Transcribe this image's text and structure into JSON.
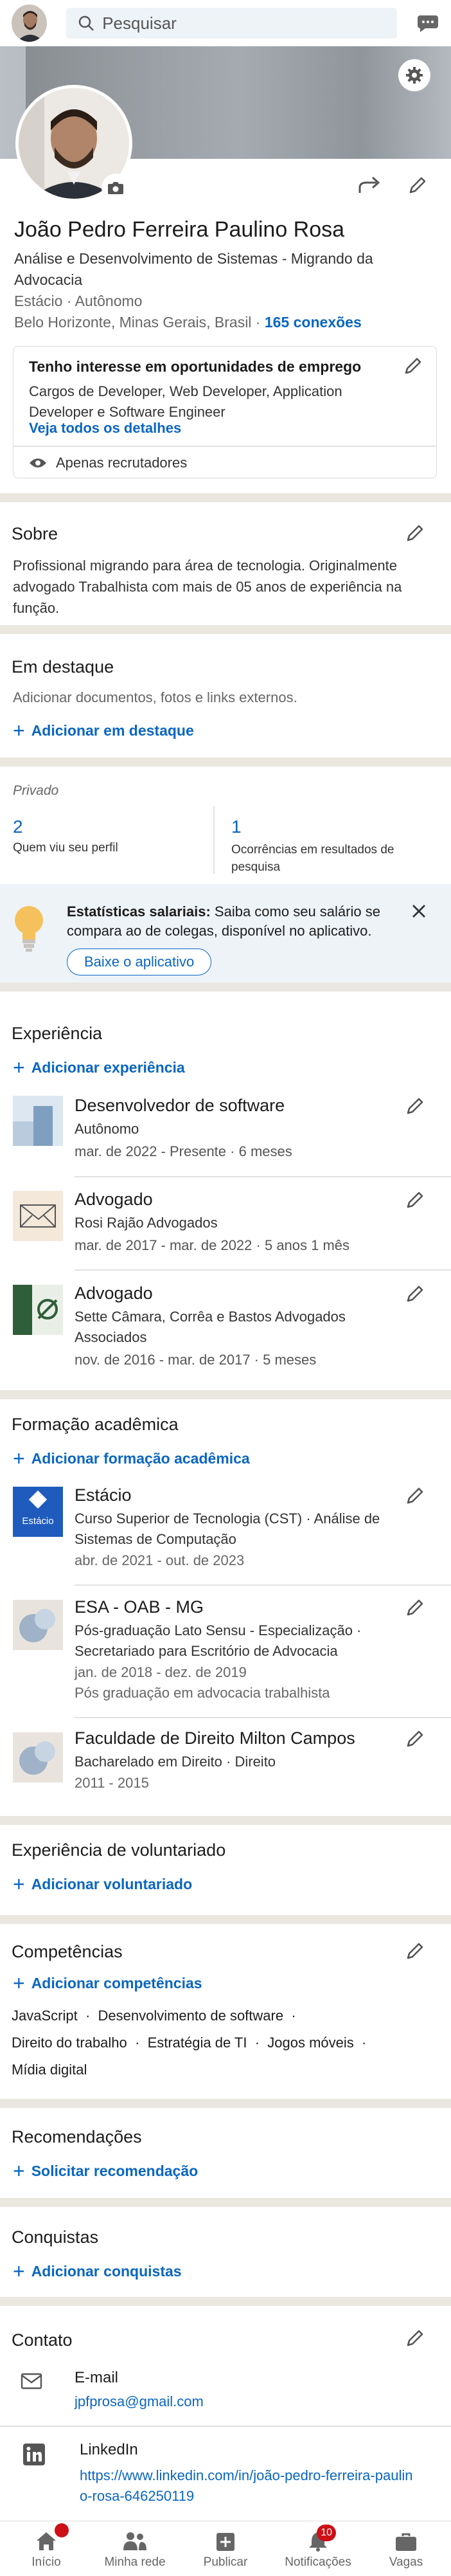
{
  "search": {
    "placeholder": "Pesquisar"
  },
  "profile": {
    "name": "João Pedro Ferreira Paulino Rosa",
    "headline": "Análise e Desenvolvimento de Sistemas - Migrando da Advocacia",
    "company": "Estácio",
    "employment": "Autônomo",
    "location": "Belo Horizonte, Minas Gerais, Brasil",
    "connections": "165 conexões"
  },
  "open_to_work": {
    "title": "Tenho interesse em oportunidades de emprego",
    "roles": "Cargos de Developer, Web Developer, Application Developer e Software Engineer",
    "link": "Veja todos os detalhes",
    "visibility": "Apenas recrutadores"
  },
  "about": {
    "title": "Sobre",
    "text": "Profissional migrando para área de tecnologia. Originalmente advogado Trabalhista com mais de 05 anos de experiência na função."
  },
  "featured": {
    "title": "Em destaque",
    "hint": "Adicionar documentos, fotos e links externos.",
    "add": "Adicionar em destaque"
  },
  "analytics": {
    "title": "Privado",
    "profile_views_count": "2",
    "profile_views_label": "Quem viu seu perfil",
    "search_count": "1",
    "search_label": "Ocorrências em resultados de pesquisa"
  },
  "salary": {
    "bold": "Estatísticas salariais:",
    "text": " Saiba como seu salário se compara ao de colegas, disponível no aplicativo.",
    "button": "Baixe o aplicativo"
  },
  "experience": {
    "title": "Experiência",
    "add": "Adicionar experiência",
    "items": [
      {
        "title": "Desenvolvedor de software",
        "company": "Autônomo",
        "dates": "mar. de 2022 - Presente",
        "duration": "6 meses"
      },
      {
        "title": "Advogado",
        "company": "Rosi Rajão Advogados",
        "dates": "mar. de 2017 - mar. de 2022",
        "duration": "5 anos 1 mês"
      },
      {
        "title": "Advogado",
        "company": "Sette Câmara, Corrêa e Bastos Advogados Associados",
        "dates": "nov. de 2016 - mar. de 2017",
        "duration": "5 meses"
      }
    ]
  },
  "education": {
    "title": "Formação acadêmica",
    "add": "Adicionar formação acadêmica",
    "items": [
      {
        "school": "Estácio",
        "logo_text": "Estácio",
        "degree": "Curso Superior de Tecnologia (CST)",
        "field": "Análise de Sistemas de Computação",
        "dates": "abr. de 2021 - out. de 2023",
        "note": ""
      },
      {
        "school": "ESA - OAB - MG",
        "degree": "Pós-graduação Lato Sensu - Especialização",
        "field": "Secretariado para Escritório de Advocacia",
        "dates": "jan. de 2018 - dez. de 2019",
        "note": "Pós graduação em advocacia trabalhista"
      },
      {
        "school": "Faculdade de Direito Milton Campos",
        "degree": "Bacharelado em Direito",
        "field": "Direito",
        "dates": "2011 - 2015",
        "note": ""
      }
    ]
  },
  "volunteer": {
    "title": "Experiência de voluntariado",
    "add": "Adicionar voluntariado"
  },
  "skills": {
    "title": "Competências",
    "add": "Adicionar competências",
    "items": [
      "JavaScript",
      "Desenvolvimento de software",
      "Direito do trabalho",
      "Estratégia de TI",
      "Jogos móveis",
      "Mídia digital"
    ]
  },
  "recommendations": {
    "title": "Recomendações",
    "add": "Solicitar recomendação"
  },
  "accomplishments": {
    "title": "Conquistas",
    "add": "Adicionar conquistas"
  },
  "contact": {
    "title": "Contato",
    "email_label": "E-mail",
    "email": "jpfprosa@gmail.com",
    "linkedin_label": "LinkedIn",
    "linkedin_url": "https://www.linkedin.com/in/joão-pedro-ferreira-paulino-rosa-646250119"
  },
  "nav": {
    "home": "Início",
    "network": "Minha rede",
    "post": "Publicar",
    "notifications": "Notificações",
    "jobs": "Vagas",
    "home_badge": "",
    "notif_badge": "10"
  },
  "colors": {
    "accent": "#0a66c2",
    "badge": "#cc1016",
    "background": "#eae7e1"
  }
}
